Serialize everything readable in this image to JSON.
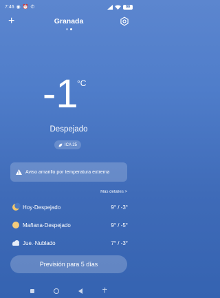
{
  "status_bar": {
    "time": "7:46",
    "battery": "88",
    "icons": [
      "whatsapp-icon",
      "alarm-icon",
      "missed-call-icon",
      "signal-icon",
      "wifi-icon",
      "battery-icon"
    ]
  },
  "header": {
    "city": "Granada",
    "add_icon": "plus-icon",
    "settings_icon": "gear-icon",
    "page_count": 2,
    "active_page": 2
  },
  "current": {
    "temperature": "-1",
    "unit": "°C",
    "condition": "Despejado",
    "aqi_label": "ICA 25"
  },
  "alert": {
    "text": "Aviso amarillo por temperatura extrema"
  },
  "more_details": "Más detalles >",
  "forecast": [
    {
      "label": "Hoy·Despejado",
      "range": "9° / -3°",
      "icon": "moon-icon"
    },
    {
      "label": "Mañana·Despejado",
      "range": "9° / -5°",
      "icon": "sun-icon"
    },
    {
      "label": "Jue.·Nublado",
      "range": "7° / -3°",
      "icon": "cloud-icon"
    }
  ],
  "forecast_button": "Previsión para 5 días",
  "colors": {
    "background_top": "#5c86cf",
    "background_bottom": "#3563b1",
    "moon": "#f2c66b",
    "sun": "#f5cb7a",
    "cloud": "#e6edf8"
  }
}
